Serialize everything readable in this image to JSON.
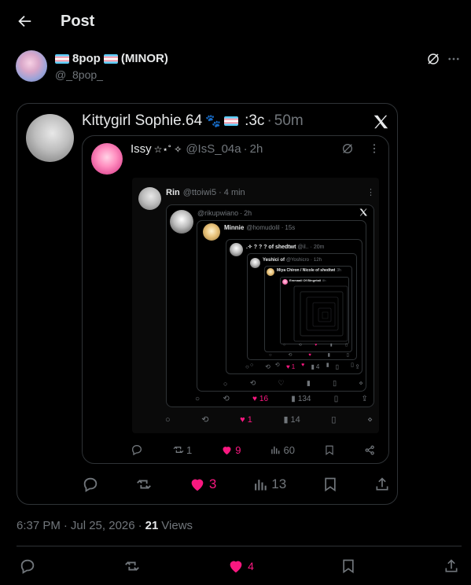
{
  "header": {
    "title": "Post"
  },
  "author": {
    "name": "8pop",
    "name_suffix": "(MINOR)",
    "handle": "@_8pop_"
  },
  "quoted": {
    "name": "Kittygirl Sophie.64",
    "name_tail": ":3c",
    "time": "50m",
    "nested": {
      "name": "Issy",
      "name_deco": "☆⋆˚ ✧",
      "handle": "@IsS_04a",
      "time": "2h",
      "rin": {
        "name": "Rin",
        "handle": "@ttoiwi5",
        "time": "4 min",
        "inner1": {
          "handle": "@rikupwiano",
          "time": "2h"
        },
        "inner2": {
          "name": "Minnie",
          "handle": "@homudolil",
          "time": "15s"
        },
        "inner3": {
          "name": ".✧ ? ? ? of shedtwt",
          "handle": "@il..",
          "time": "20m"
        },
        "inner4": {
          "name": "Yeshici of",
          "handle": "@Yoshicro",
          "time": "12h"
        },
        "inner5": {
          "name": "Miya Chiron / Nicole of shedtwt",
          "time": "3h"
        },
        "inner6": {
          "name": "Emmaali Of Bingetail",
          "time": "8h"
        },
        "actions": {
          "retweets": "",
          "likes": "1",
          "views": "14"
        },
        "inner1_actions": {
          "likes": "16",
          "views": "134"
        },
        "inner2_actions": {
          "likes": "1",
          "views": "4"
        }
      },
      "actions": {
        "retweets": "1",
        "likes": "9",
        "views": "60"
      }
    },
    "actions": {
      "likes": "3",
      "views": "13"
    }
  },
  "meta": {
    "time": "6:37 PM",
    "date": "Jul 25, 2026",
    "views_count": "21",
    "views_label": "Views"
  },
  "bottom_bar": {
    "likes": "4"
  },
  "colors": {
    "background": "#000000",
    "text": "#e7e9ea",
    "muted": "#71767b",
    "like": "#f91880",
    "border": "#2f3336"
  },
  "icons": [
    "back-arrow-icon",
    "grok-icon",
    "more-icon",
    "x-logo-icon",
    "reply-icon",
    "retweet-icon",
    "heart-icon",
    "views-icon",
    "bookmark-icon",
    "share-icon"
  ]
}
